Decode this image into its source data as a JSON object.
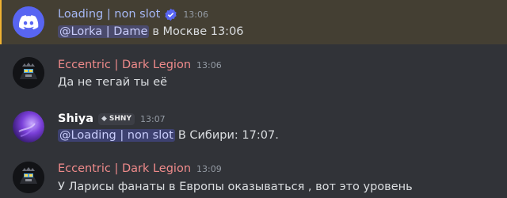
{
  "colors": {
    "background": "#313338",
    "highlight_bg": "#443f33",
    "highlight_border": "#f0b232",
    "loading_name": "#a6b8f5",
    "eccentric_name": "#f08b8b",
    "shiya_name": "#ffffff",
    "mention_bg": "#41447a",
    "verified": "#5865f2"
  },
  "messages": [
    {
      "author": "Loading | non slot",
      "time": "13:06",
      "icons": [
        "discord-logo-avatar",
        "verified-check-icon"
      ],
      "mention": "@Lorka | Dame",
      "text": "в Москве 13:06"
    },
    {
      "author": "Eccentric | Dark Legion",
      "time": "13:06",
      "icons": [
        "dark-skull-avatar"
      ],
      "text": "Да не тегай ты её"
    },
    {
      "author": "Shiya",
      "time": "13:07",
      "badge": "SHNY",
      "icons": [
        "purple-swirl-avatar",
        "gem-icon"
      ],
      "mention": "@Loading | non slot",
      "text": "В Сибири: 17:07."
    },
    {
      "author": "Eccentric | Dark Legion",
      "time": "13:09",
      "icons": [
        "dark-skull-avatar"
      ],
      "text": "У Ларисы фанаты в Европы оказываться , вот это уровень"
    }
  ]
}
